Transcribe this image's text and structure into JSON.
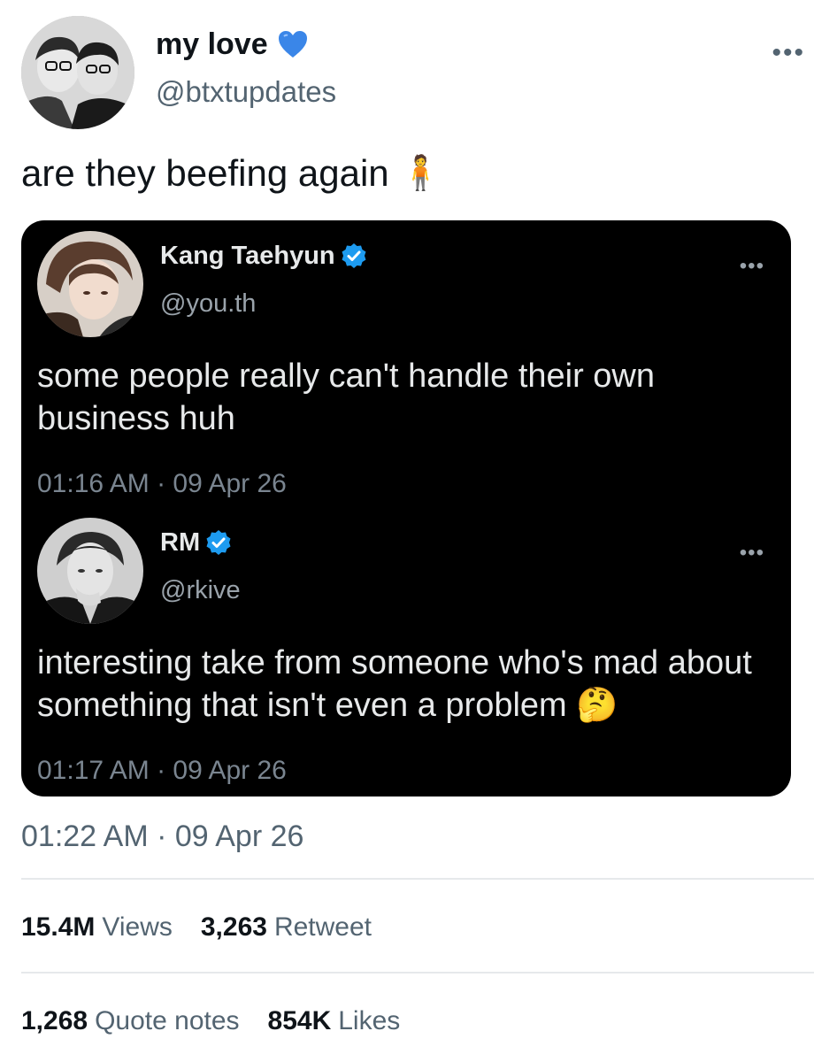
{
  "tweet": {
    "display_name": "my love",
    "name_icon": "blue-heart",
    "handle": "@btxtupdates",
    "more": "•••",
    "text": "are they beefing again",
    "text_emoji": "🧍",
    "timestamp": "01:22 AM · 09 Apr 26"
  },
  "quoted": [
    {
      "name": "Kang Taehyun",
      "handle": "@you.th",
      "more": "•••",
      "text": "some people really can't handle their own business huh",
      "timestamp": "01:16 AM · 09 Apr 26",
      "verified": true
    },
    {
      "name": "RM",
      "handle": "@rkive",
      "more": "•••",
      "text": "interesting take from someone who's mad about something that isn't even a problem",
      "text_emoji": "🤔",
      "timestamp": "01:17 AM · 09 Apr 26",
      "verified": true
    }
  ],
  "stats": {
    "views_count": "15.4M",
    "views_label": "Views",
    "retweets_count": "3,263",
    "retweets_label": "Retweet",
    "quotes_count": "1,268",
    "quotes_label": "Quote notes",
    "likes_count": "854K",
    "likes_label": "Likes"
  },
  "colors": {
    "verified": "#1d9bf0",
    "heart": "#1d9bf0",
    "card_bg": "#000000"
  }
}
